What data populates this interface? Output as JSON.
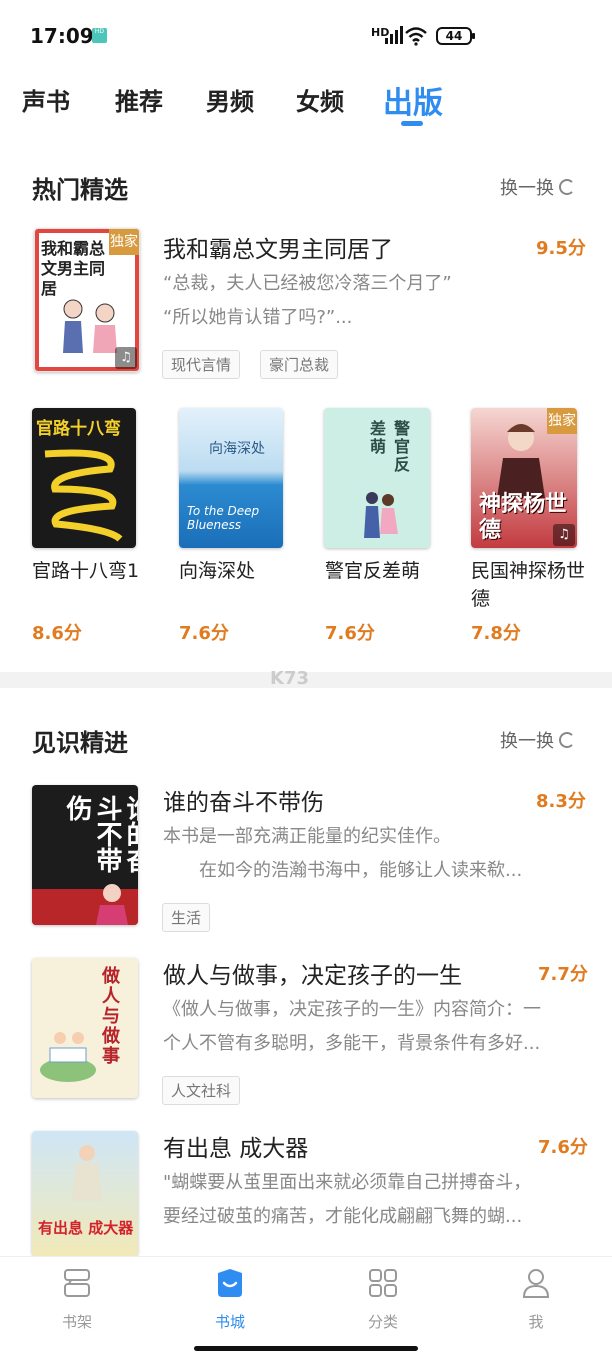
{
  "status": {
    "time": "17:09",
    "hd": "HD",
    "battery": "44"
  },
  "tabs": [
    {
      "label": "声书"
    },
    {
      "label": "推荐"
    },
    {
      "label": "男频"
    },
    {
      "label": "女频"
    },
    {
      "label": "出版"
    }
  ],
  "hot": {
    "title": "热门精选",
    "refresh": "换一换",
    "featured": {
      "title": "我和霸总文男主同居了",
      "score": "9.5分",
      "desc1": "“总裁，夫人已经被您冷落三个月了”",
      "desc2": "“所以她肯认错了吗?”...",
      "tags": [
        "现代言情",
        "豪门总裁"
      ],
      "cover_text": "我和霸总文男主同居",
      "badge": "独家"
    },
    "grid": [
      {
        "name": "官路十八弯1",
        "score": "8.6分",
        "cover_text": "官路十八弯"
      },
      {
        "name": "向海深处",
        "score": "7.6分",
        "cover_text": "向海深处",
        "cover_en": "To the Deep Blueness"
      },
      {
        "name": "警官反差萌",
        "score": "7.6分",
        "cover_text": "警官反差萌"
      },
      {
        "name": "民国神探杨世德",
        "score": "7.8分",
        "cover_text": "神探杨世德",
        "badge": "独家"
      }
    ]
  },
  "insight": {
    "title": "见识精进",
    "refresh": "换一换",
    "items": [
      {
        "title": "谁的奋斗不带伤",
        "score": "8.3分",
        "desc1": "本书是一部充满正能量的纪实佳作。",
        "desc2": "　　在如今的浩瀚书海中，能够让人读来欷...",
        "tag": "生活",
        "cover_text": "谁的奋斗不带伤"
      },
      {
        "title": "做人与做事，决定孩子的一生",
        "score": "7.7分",
        "desc1": "《做人与做事，决定孩子的一生》内容简介：一",
        "desc2": "个人不管有多聪明，多能干，背景条件有多好...",
        "tag": "人文社科",
        "cover_text": "做人与做事"
      },
      {
        "title": "有出息 成大器",
        "score": "7.6分",
        "desc1": "\"蝴蝶要从茧里面出来就必须靠自己拼搏奋斗，",
        "desc2": "要经过破茧的痛苦，才能化成翩翩飞舞的蝴...",
        "tag": "",
        "cover_text": "有出息 成大器"
      }
    ]
  },
  "watermark": "K73",
  "bottom_nav": [
    {
      "label": "书架",
      "icon": "bookshelf-icon"
    },
    {
      "label": "书城",
      "icon": "bookstore-icon"
    },
    {
      "label": "分类",
      "icon": "category-icon"
    },
    {
      "label": "我",
      "icon": "profile-icon"
    }
  ],
  "colors": {
    "accent": "#2f8cf0",
    "score": "#e07b1f"
  }
}
